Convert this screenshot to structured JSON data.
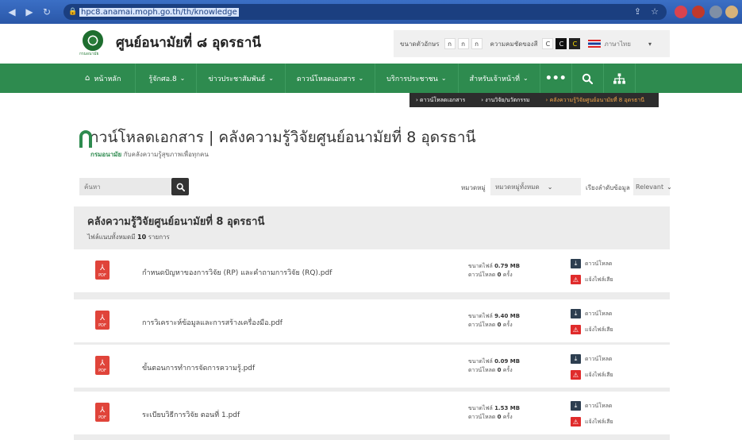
{
  "browser": {
    "url": "hpc8.anamai.moph.go.th/th/knowledge"
  },
  "header": {
    "site_title": "ศูนย์อนามัยที่ ๘ อุดรธานี",
    "logo_caption": "กรมอนามัย",
    "font_size_label": "ขนาดตัวอักษร",
    "font_size_options": [
      "ก",
      "ก",
      "ก"
    ],
    "contrast_label": "ความคมชัดของสี",
    "contrast_options": [
      "C",
      "C",
      "C"
    ],
    "language": "ภาษาไทย"
  },
  "nav": {
    "items": [
      {
        "label": "หน้าหลัก",
        "icon": "home-icon"
      },
      {
        "label": "รู้จักศอ.8"
      },
      {
        "label": "ข่าวประชาสัมพันธ์"
      },
      {
        "label": "ดาวน์โหลดเอกสาร"
      },
      {
        "label": "บริการประชาชน"
      },
      {
        "label": "สำหรับเจ้าหน้าที่"
      }
    ],
    "more": "•••",
    "search_icon": "⚲",
    "sitemap_icon": "sitemap-icon"
  },
  "breadcrumb": {
    "items": [
      "ดาวน์โหลดเอกสาร",
      "งานวิจัย/นวัตกรรม",
      "คลังความรู้วิจัยศูนย์อนามัยที่ 8 อุดรธานี"
    ]
  },
  "page": {
    "title": "าวน์โหลดเอกสาร | คลังความรู้วิจัยศูนย์อนามัยที่ 8 อุดรธานี",
    "subtitle_brand": "กรมอนามัย",
    "subtitle_rest": "กับคลังความรู้สุขภาพเพื่อทุกคน"
  },
  "search": {
    "placeholder": "ค้นหา",
    "category_label": "หมวดหมู่",
    "category_value": "หมวดหมู่ทั้งหมด",
    "sort_label": "เรียงลำดับข้อมูล",
    "sort_value": "Relevant"
  },
  "panel": {
    "title": "คลังความรู้วิจัยศูนย์อนามัยที่ 8 อุดรธานี",
    "count_prefix": "ไฟล์แนบทั้งหมดมี",
    "count_value": "10",
    "count_suffix": "รายการ"
  },
  "files": [
    {
      "name": "กำหนดปัญหาของการวิจัย (RP) และคำถามการวิจัย (RQ).pdf",
      "size_label": "ขนาดไฟล์",
      "size": "0.79 MB",
      "dl_label": "ดาวน์โหลด",
      "dl_count": "0",
      "dl_unit": "ครั้ง",
      "download": "ดาวน์โหลด",
      "report": "แจ้งไฟล์เสีย"
    },
    {
      "name": "การวิเคราะห์ข้อมูลและการสร้างเครื่องมือ.pdf",
      "size_label": "ขนาดไฟล์",
      "size": "9.40 MB",
      "dl_label": "ดาวน์โหลด",
      "dl_count": "0",
      "dl_unit": "ครั้ง",
      "download": "ดาวน์โหลด",
      "report": "แจ้งไฟล์เสีย"
    },
    {
      "name": "ขั้นตอนการทำการจัดการความรู้.pdf",
      "size_label": "ขนาดไฟล์",
      "size": "0.09 MB",
      "dl_label": "ดาวน์โหลด",
      "dl_count": "0",
      "dl_unit": "ครั้ง",
      "download": "ดาวน์โหลด",
      "report": "แจ้งไฟล์เสีย"
    },
    {
      "name": "ระเบียบวิธีการวิจัย ตอนที่ 1.pdf",
      "size_label": "ขนาดไฟล์",
      "size": "1.53 MB",
      "dl_label": "ดาวน์โหลด",
      "dl_count": "0",
      "dl_unit": "ครั้ง",
      "download": "ดาวน์โหลด",
      "report": "แจ้งไฟล์เสีย"
    }
  ],
  "colors": {
    "nav_green": "#2e8b4f",
    "pdf_red": "#e0443a",
    "breadcrumb_current": "#f2a54a"
  }
}
